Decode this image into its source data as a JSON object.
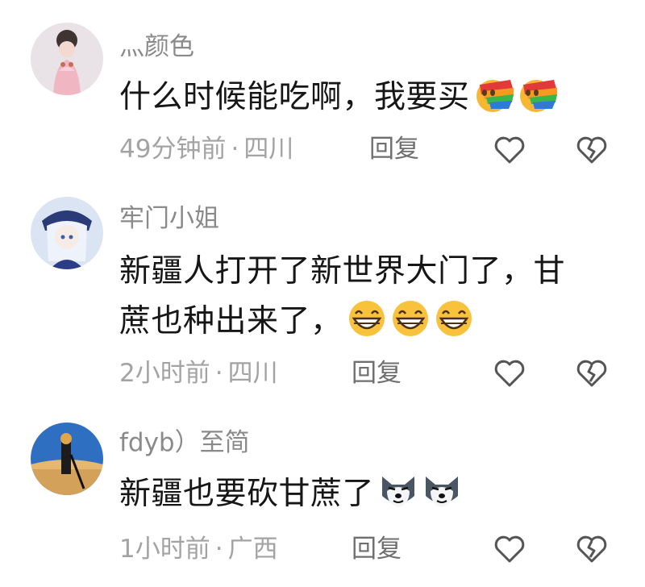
{
  "comments": [
    {
      "username": "灬颜色",
      "text": "什么时候能吃啊，我要买",
      "emojis": [
        "rainbow-vomit-emoji",
        "rainbow-vomit-emoji"
      ],
      "time": "49分钟前",
      "location": "四川",
      "separator": "·",
      "reply_label": "回复"
    },
    {
      "username": "牢门小姐",
      "text_line1": "新疆人打开了新世界大门了，甘",
      "text_line2": "蔗也种出来了，",
      "emojis": [
        "grin-emoji",
        "grin-emoji",
        "grin-emoji"
      ],
      "time": "2小时前",
      "location": "四川",
      "separator": "·",
      "reply_label": "回复"
    },
    {
      "username": "fdyb）至简",
      "text": "新疆也要砍甘蔗了",
      "emojis": [
        "husky-emoji",
        "husky-emoji"
      ],
      "time": "1小时前",
      "location": "广西",
      "separator": "·",
      "reply_label": "回复"
    }
  ],
  "icons": {
    "like": "heart-outline-icon",
    "dislike": "broken-heart-outline-icon"
  },
  "colors": {
    "username": "#8a8a8a",
    "text": "#161616",
    "meta": "#a3a3a3",
    "reply": "#6f6f6f",
    "icon_stroke": "#555555"
  }
}
